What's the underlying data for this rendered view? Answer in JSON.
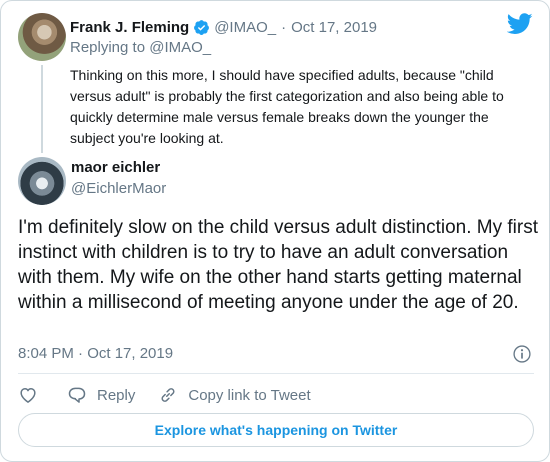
{
  "colors": {
    "brand_blue": "#1da1f2",
    "link_blue": "#1b95e0",
    "secondary_text": "#657786",
    "border": "#cfd9de"
  },
  "parent_tweet": {
    "author_name": "Frank J. Fleming",
    "verified_icon": "verified-badge-icon",
    "handle": "@IMAO_",
    "separator": "·",
    "date": "Oct 17, 2019",
    "replying_to": "Replying to @IMAO_",
    "text": "Thinking on this more, I should have specified adults, because \"child versus adult\" is probably the first categorization and also being able to quickly determine male versus female breaks down the younger the subject you're looking at."
  },
  "main_tweet": {
    "author_name": "maor eichler",
    "handle": "@EichlerMaor",
    "text": "I'm definitely slow on the child versus adult distinction. My first instinct with children is to try to have an adult conversation with them. My wife on the other hand  starts getting maternal within a millisecond of meeting anyone under the age of 20.",
    "timestamp": "8:04 PM · Oct 17, 2019"
  },
  "actions": {
    "like_icon": "heart-icon",
    "reply_label": "Reply",
    "copy_link_label": "Copy link to Tweet"
  },
  "explore_button": {
    "label": "Explore what's happening on Twitter"
  }
}
